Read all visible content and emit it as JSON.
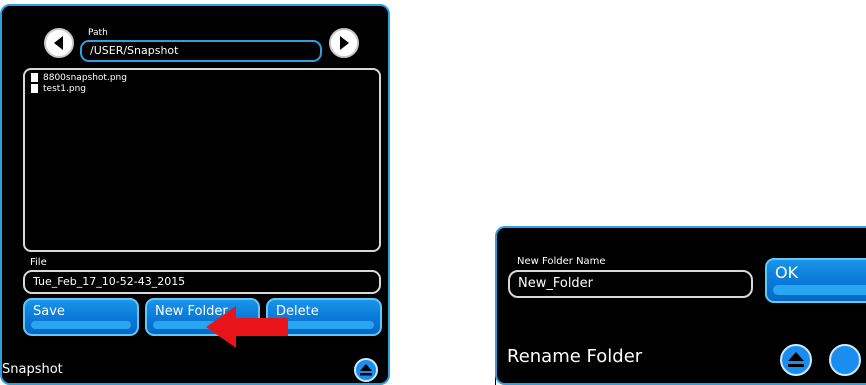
{
  "snapshot_dialog": {
    "path_label": "Path",
    "path_value": "/USER/Snapshot",
    "files": [
      "8800snapshot.png",
      "test1.png"
    ],
    "file_label": "File",
    "file_value": "Tue_Feb_17_10-52-43_2015",
    "buttons": {
      "save": "Save",
      "new_folder": "New Folder",
      "delete": "Delete"
    },
    "title": "Snapshot",
    "icons": {
      "back": "arrow-left-icon",
      "forward": "arrow-right-icon",
      "collapse": "collapse-icon",
      "file": "file-icon",
      "pointer": "red-arrow-icon"
    }
  },
  "rename_dialog": {
    "field_label": "New Folder Name",
    "field_value": "New_Folder",
    "ok_label": "OK",
    "title": "Rename Folder",
    "icons": {
      "collapse": "collapse-icon",
      "extra": "circle-button-icon"
    }
  },
  "colors": {
    "panel_bg": "#000000",
    "accent_border": "#2e9fe0",
    "button_blue": "#0a78d8",
    "field_border": "#d8d8d8",
    "pointer_red": "#e8141a"
  }
}
